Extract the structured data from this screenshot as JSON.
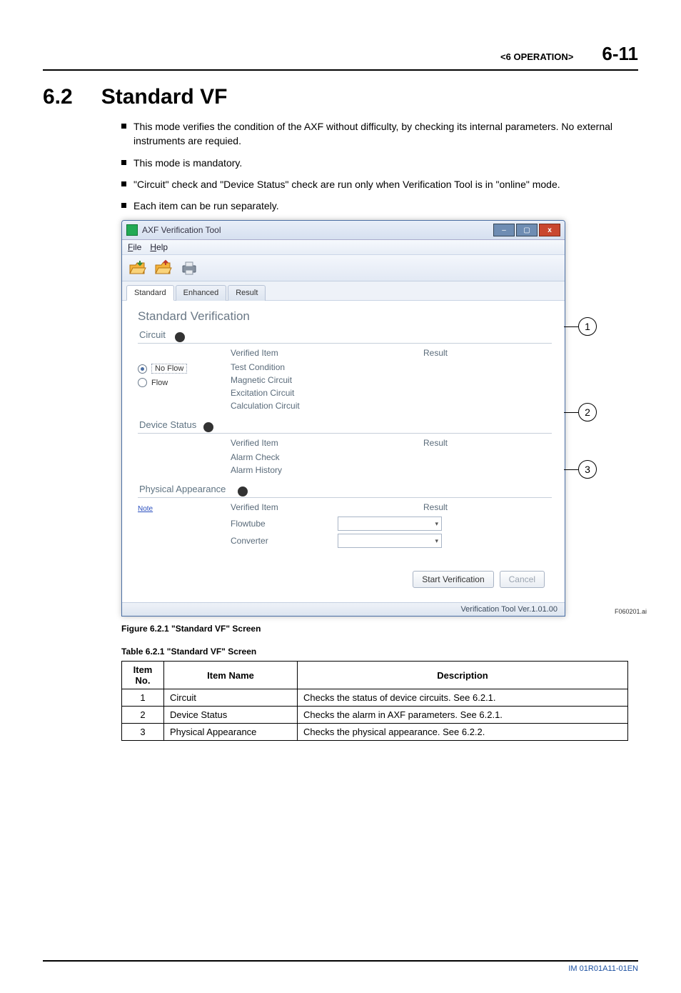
{
  "header": {
    "chapter": "<6  OPERATION>",
    "page": "6-11"
  },
  "section": {
    "num": "6.2",
    "title": "Standard VF"
  },
  "bullets": [
    "This mode verifies the condition of the AXF without difficulty, by checking its internal parameters. No external instruments are requied.",
    "This mode is mandatory.",
    "\"Circuit\" check and \"Device Status\" check are run only when Verification Tool is in \"online\" mode.",
    "Each item can be run separately."
  ],
  "app": {
    "title": "AXF Verification Tool",
    "menus": {
      "file": "File",
      "help": "Help"
    },
    "tabs": {
      "standard": "Standard",
      "enhanced": "Enhanced",
      "result": "Result"
    },
    "heading": "Standard Verification",
    "circuit": {
      "label": "Circuit",
      "radios": {
        "noflow": "No Flow",
        "flow": "Flow"
      },
      "head_item": "Verified Item",
      "head_result": "Result",
      "rows": [
        "Test Condition",
        "Magnetic Circuit",
        "Excitation Circuit",
        "Calculation Circuit"
      ]
    },
    "device": {
      "label": "Device Status",
      "head_item": "Verified Item",
      "head_result": "Result",
      "rows": [
        "Alarm Check",
        "Alarm History"
      ]
    },
    "physical": {
      "label": "Physical Appearance",
      "note": "Note",
      "head_item": "Verified Item",
      "head_result": "Result",
      "rows": [
        "Flowtube",
        "Converter"
      ]
    },
    "buttons": {
      "start": "Start Verification",
      "cancel": "Cancel"
    },
    "status": "Verification Tool Ver.1.01.00"
  },
  "callouts": {
    "c1": "1",
    "c2": "2",
    "c3": "3"
  },
  "fig_label_right": "F060201.ai",
  "fig_caption": "Figure 6.2.1 \"Standard VF\" Screen",
  "table_caption": "Table 6.2.1 \"Standard VF\" Screen",
  "table": {
    "head": {
      "no": "Item No.",
      "name": "Item Name",
      "desc": "Description"
    },
    "rows": [
      {
        "no": "1",
        "name": "Circuit",
        "desc": "Checks the status of device circuits. See 6.2.1."
      },
      {
        "no": "2",
        "name": "Device Status",
        "desc": "Checks the alarm in AXF parameters. See 6.2.1."
      },
      {
        "no": "3",
        "name": "Physical Appearance",
        "desc": "Checks the physical appearance. See 6.2.2."
      }
    ]
  },
  "footer": "IM 01R01A11-01EN"
}
